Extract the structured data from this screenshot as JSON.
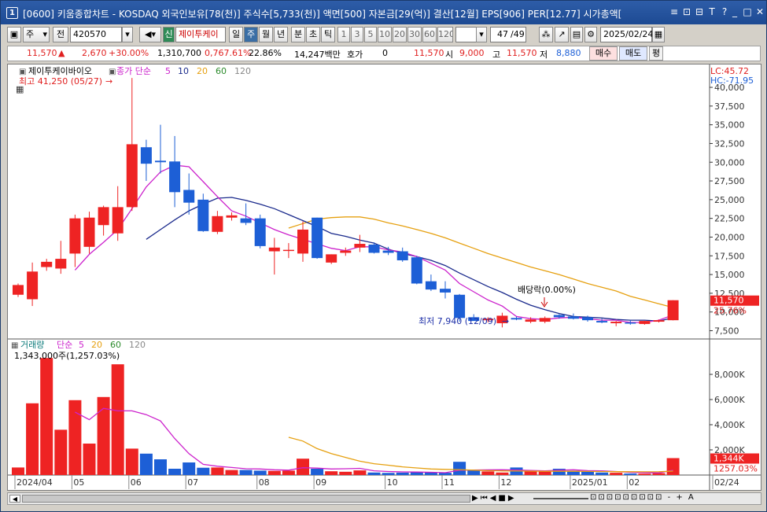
{
  "window": {
    "num": "1",
    "title": "[0600] 키움종합차트 - KOSDAQ 외국인보유[78(천)] 주식수[5,733(천)] 액면[500] 자본금[29(억)] 결산[12월] EPS[906] PER[12.77] 시가총액[",
    "controls": [
      "≡",
      "⊡",
      "⊟",
      "T",
      "?",
      "_",
      "□",
      "✕"
    ]
  },
  "toolbar": {
    "period_label": "주",
    "prev_label": "전",
    "code": "420570",
    "name_tag": "신",
    "name": "제이투케이",
    "periods": [
      "일",
      "주",
      "월",
      "년",
      "분",
      "초",
      "틱"
    ],
    "selected_period": "주",
    "intervals": [
      "1",
      "3",
      "5",
      "10",
      "20",
      "30",
      "60",
      "120"
    ],
    "count": "47",
    "count_total": "/49",
    "date": "2025/02/24"
  },
  "quote": {
    "price": "11,570",
    "arrow": "▲",
    "change": "2,670",
    "change_pct": "+30.00%",
    "volume": "1,310,700",
    "vol_ratio": "0,767.61%",
    "turnover": "22.86%",
    "amount": "14,247백만",
    "hoga_label": "호가",
    "hoga_val": "0",
    "hoga_price": "11,570",
    "open_label": "시",
    "open": "9,000",
    "high_label": "고",
    "high": "11,570",
    "low_label": "저",
    "low": "8,880",
    "buy": "매수",
    "sell": "매도",
    "avg": "평"
  },
  "price_panel": {
    "stock_name": "제이투케이바이오",
    "ma_title": "종가 단순",
    "ma_periods": [
      "5",
      "10",
      "20",
      "60",
      "120"
    ],
    "high_note": "최고 41,250 (05/27)",
    "low_note": "최저 7,940 (12/09)",
    "event": "배당락(0.00%)",
    "lc": "LC:45.72",
    "hc": "HC:-71.95",
    "last_price": "11,570",
    "last_pct": "25.76%"
  },
  "volume_panel": {
    "title": "거래량",
    "ma_title": "단순",
    "ma_periods": [
      "5",
      "20",
      "60",
      "120"
    ],
    "info": "1,343,000주(1,257.03%)",
    "last_vol": "1,344K",
    "last_pct": "1257.03%"
  },
  "colors": {
    "up": "#ee2323",
    "down": "#1d5fd6",
    "ma5": "#cc22cc",
    "ma10": "#1a2a8c",
    "ma20": "#e6a010"
  },
  "chart_data": {
    "type": "candlestick",
    "ylim": [
      6500,
      42000
    ],
    "yticks": [
      7500,
      10000,
      12500,
      15000,
      17500,
      20000,
      22500,
      25000,
      27500,
      30000,
      32500,
      35000,
      37500,
      40000
    ],
    "vlim": [
      0,
      9500
    ],
    "vticks": [
      2000,
      4000,
      6000,
      8000
    ],
    "x_labels": [
      {
        "i": 0,
        "t": "2024/04"
      },
      {
        "i": 4,
        "t": "05"
      },
      {
        "i": 8,
        "t": "06"
      },
      {
        "i": 12,
        "t": "07"
      },
      {
        "i": 17,
        "t": "08"
      },
      {
        "i": 21,
        "t": "09"
      },
      {
        "i": 26,
        "t": "10"
      },
      {
        "i": 30,
        "t": "11"
      },
      {
        "i": 34,
        "t": "12"
      },
      {
        "i": 39,
        "t": "2025/01"
      },
      {
        "i": 43,
        "t": "02"
      },
      {
        "i": 49,
        "t": "02/24"
      }
    ],
    "candles": [
      {
        "o": 12300,
        "h": 13800,
        "l": 12000,
        "c": 13600
      },
      {
        "o": 11700,
        "h": 16600,
        "l": 10800,
        "c": 15400
      },
      {
        "o": 16000,
        "h": 17100,
        "l": 15500,
        "c": 16700
      },
      {
        "o": 15800,
        "h": 19500,
        "l": 15100,
        "c": 17100
      },
      {
        "o": 17800,
        "h": 23000,
        "l": 16000,
        "c": 22500
      },
      {
        "o": 18700,
        "h": 23400,
        "l": 17800,
        "c": 22600
      },
      {
        "o": 21600,
        "h": 24200,
        "l": 20200,
        "c": 24000
      },
      {
        "o": 20500,
        "h": 26800,
        "l": 19500,
        "c": 24000
      },
      {
        "o": 24000,
        "h": 41250,
        "l": 23500,
        "c": 32400
      },
      {
        "o": 32000,
        "h": 33000,
        "l": 27500,
        "c": 29800
      },
      {
        "o": 30200,
        "h": 35000,
        "l": 28500,
        "c": 30000
      },
      {
        "o": 30100,
        "h": 33500,
        "l": 24000,
        "c": 26000
      },
      {
        "o": 26300,
        "h": 28500,
        "l": 23000,
        "c": 24600
      },
      {
        "o": 25000,
        "h": 25800,
        "l": 20700,
        "c": 20800
      },
      {
        "o": 20700,
        "h": 23500,
        "l": 20400,
        "c": 22800
      },
      {
        "o": 22600,
        "h": 23300,
        "l": 22200,
        "c": 22900
      },
      {
        "o": 22500,
        "h": 24500,
        "l": 21600,
        "c": 21900
      },
      {
        "o": 22500,
        "h": 23000,
        "l": 18500,
        "c": 18800
      },
      {
        "o": 18100,
        "h": 19900,
        "l": 15000,
        "c": 18600
      },
      {
        "o": 18200,
        "h": 19200,
        "l": 17200,
        "c": 18300
      },
      {
        "o": 17800,
        "h": 22100,
        "l": 16700,
        "c": 21000
      },
      {
        "o": 22600,
        "h": 22600,
        "l": 17100,
        "c": 17200
      },
      {
        "o": 16600,
        "h": 17700,
        "l": 16400,
        "c": 17700
      },
      {
        "o": 17900,
        "h": 18600,
        "l": 17500,
        "c": 18200
      },
      {
        "o": 18600,
        "h": 20300,
        "l": 18000,
        "c": 19100
      },
      {
        "o": 19000,
        "h": 19300,
        "l": 17800,
        "c": 17900
      },
      {
        "o": 18200,
        "h": 18700,
        "l": 17600,
        "c": 17900
      },
      {
        "o": 18100,
        "h": 18600,
        "l": 16700,
        "c": 16900
      },
      {
        "o": 17300,
        "h": 17500,
        "l": 13700,
        "c": 13800
      },
      {
        "o": 14100,
        "h": 15000,
        "l": 12800,
        "c": 13000
      },
      {
        "o": 13100,
        "h": 14100,
        "l": 11800,
        "c": 12600
      },
      {
        "o": 12300,
        "h": 12400,
        "l": 8700,
        "c": 9200
      },
      {
        "o": 9300,
        "h": 9700,
        "l": 8900,
        "c": 8800
      },
      {
        "o": 8900,
        "h": 9300,
        "l": 8600,
        "c": 9100
      },
      {
        "o": 8500,
        "h": 9900,
        "l": 7940,
        "c": 9500
      },
      {
        "o": 9200,
        "h": 9400,
        "l": 8900,
        "c": 9000
      },
      {
        "o": 8700,
        "h": 9300,
        "l": 8500,
        "c": 9000
      },
      {
        "o": 8700,
        "h": 9400,
        "l": 8500,
        "c": 9200
      },
      {
        "o": 9600,
        "h": 9700,
        "l": 9100,
        "c": 9300
      },
      {
        "o": 9400,
        "h": 9800,
        "l": 9000,
        "c": 9100
      },
      {
        "o": 9300,
        "h": 9500,
        "l": 8700,
        "c": 8900
      },
      {
        "o": 8800,
        "h": 9100,
        "l": 8500,
        "c": 8600
      },
      {
        "o": 8500,
        "h": 8800,
        "l": 8100,
        "c": 8700
      },
      {
        "o": 8600,
        "h": 8900,
        "l": 8300,
        "c": 8500
      },
      {
        "o": 8400,
        "h": 8800,
        "l": 8300,
        "c": 8800
      },
      {
        "o": 8700,
        "h": 9000,
        "l": 8600,
        "c": 8900
      },
      {
        "o": 8900,
        "h": 11570,
        "l": 8880,
        "c": 11570
      }
    ],
    "volumes": [
      600,
      5700,
      9300,
      3600,
      5950,
      2500,
      6200,
      8800,
      2100,
      1700,
      1250,
      500,
      1000,
      580,
      600,
      400,
      400,
      350,
      330,
      350,
      1300,
      500,
      300,
      260,
      370,
      200,
      170,
      190,
      250,
      200,
      180,
      1050,
      380,
      290,
      200,
      600,
      320,
      280,
      500,
      350,
      300,
      200,
      180,
      120,
      110,
      150,
      1344
    ],
    "ma5": [
      null,
      null,
      null,
      null,
      15600,
      17700,
      19300,
      21000,
      23800,
      26700,
      28700,
      29600,
      29400,
      27400,
      25400,
      23500,
      22800,
      21900,
      21000,
      20300,
      19700,
      19100,
      18500,
      18200,
      18700,
      18700,
      18300,
      18000,
      17400,
      16500,
      15600,
      13800,
      12700,
      11600,
      10800,
      9400,
      9100,
      9000,
      9200,
      9300,
      9100,
      8900,
      8900,
      8600,
      8600,
      8900,
      9600
    ],
    "ma10": [
      null,
      null,
      null,
      null,
      null,
      null,
      null,
      null,
      null,
      19700,
      21000,
      22300,
      23500,
      24400,
      25200,
      25300,
      24900,
      24400,
      23800,
      23000,
      22200,
      21400,
      20500,
      20100,
      19600,
      19200,
      18400,
      17800,
      17400,
      16900,
      16200,
      15200,
      14300,
      13400,
      12600,
      11700,
      10900,
      10300,
      9800,
      9400,
      9300,
      9200,
      9000,
      8900,
      8900,
      8800,
      9200
    ],
    "ma20": [
      null,
      null,
      null,
      null,
      null,
      null,
      null,
      null,
      null,
      null,
      null,
      null,
      null,
      null,
      null,
      null,
      null,
      null,
      null,
      21200,
      21800,
      22400,
      22600,
      22700,
      22700,
      22400,
      21900,
      21500,
      21000,
      20500,
      19900,
      19200,
      18500,
      17800,
      17200,
      16600,
      16000,
      15500,
      15000,
      14400,
      13800,
      13300,
      12800,
      12100,
      11600,
      11100,
      10600
    ],
    "vma5": [
      null,
      null,
      null,
      null,
      5000,
      4400,
      5300,
      5100,
      5100,
      4800,
      4300,
      2900,
      1700,
      850,
      700,
      600,
      500,
      480,
      420,
      390,
      580,
      550,
      480,
      500,
      530,
      340,
      280,
      250,
      240,
      220,
      190,
      380,
      400,
      410,
      420,
      400,
      360,
      340,
      380,
      420,
      350,
      330,
      280,
      210,
      190,
      170,
      380
    ],
    "vma20": [
      null,
      null,
      null,
      null,
      null,
      null,
      null,
      null,
      null,
      null,
      null,
      null,
      null,
      null,
      null,
      null,
      null,
      null,
      null,
      3000,
      2700,
      2100,
      1700,
      1400,
      1100,
      900,
      780,
      650,
      560,
      480,
      450,
      430,
      390,
      350,
      330,
      320,
      310,
      300,
      300,
      300,
      290,
      280,
      270,
      260,
      255,
      260,
      310
    ]
  }
}
